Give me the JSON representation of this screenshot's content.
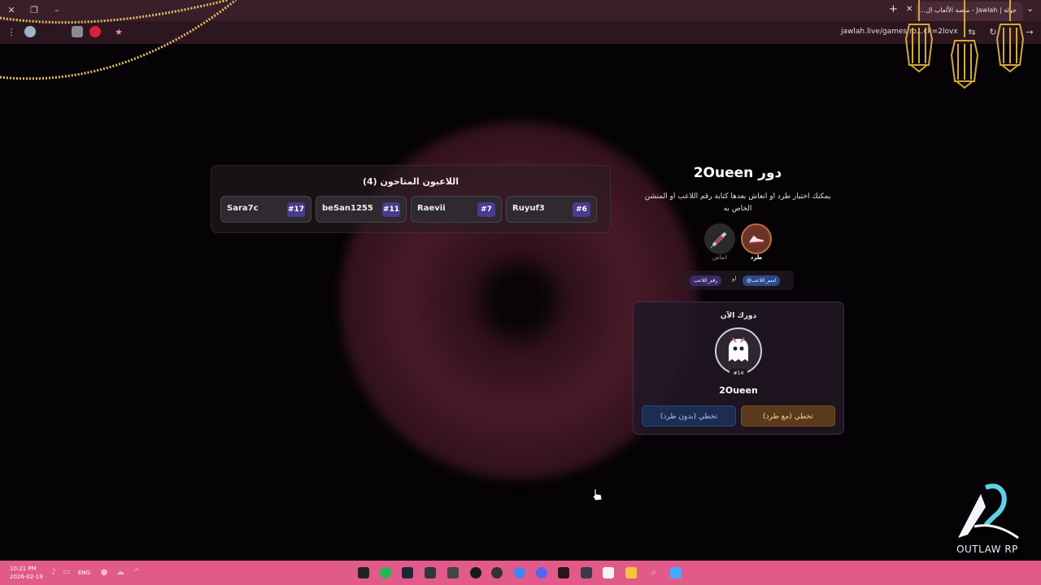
{
  "browser": {
    "tab_title": "جولة | Jawlah - منصة الألعاب ال...",
    "url": "jawlah.live/games/ro...ck=2lovx"
  },
  "players_panel": {
    "title": "اللاعبون المتاحون (4)",
    "players": [
      {
        "name": "Sara7c",
        "number": "#17"
      },
      {
        "name": "beSan1255",
        "number": "#11"
      },
      {
        "name": "Raevii",
        "number": "#7"
      },
      {
        "name": "Ruyuf3",
        "number": "#6"
      }
    ]
  },
  "turn": {
    "title": "دور 2Oueen",
    "description": "يمكنك اختيار طرد او انعاش بعدها كتابة رقم اللاعب او المنشن الخاص به",
    "actions": [
      {
        "label": "طرد",
        "icon": "kick-sneaker-icon"
      },
      {
        "label": "انعاش",
        "icon": "syringe-icon"
      }
    ],
    "hint": {
      "chip_name": "@اسم_اللاعب",
      "or": "او",
      "chip_number": "رقم_اللاعب"
    }
  },
  "now_card": {
    "title": "دورك الآن",
    "badge": "#14",
    "name": "2Oueen",
    "skip_with_kick": "تخطي (مع طرد)",
    "skip_without_kick": "تخطي (بدون طرد)"
  },
  "logo": {
    "text": "OUTLAW RP"
  },
  "taskbar": {
    "time": "10:21 PM",
    "date": "2026-02-19",
    "language": "ENG"
  },
  "colors": {
    "taskbar": "#e25a8a",
    "number_badge": "#4a3b8f",
    "skip_kick": "#5a3a1c",
    "skip_nokick": "#1c2d52"
  }
}
